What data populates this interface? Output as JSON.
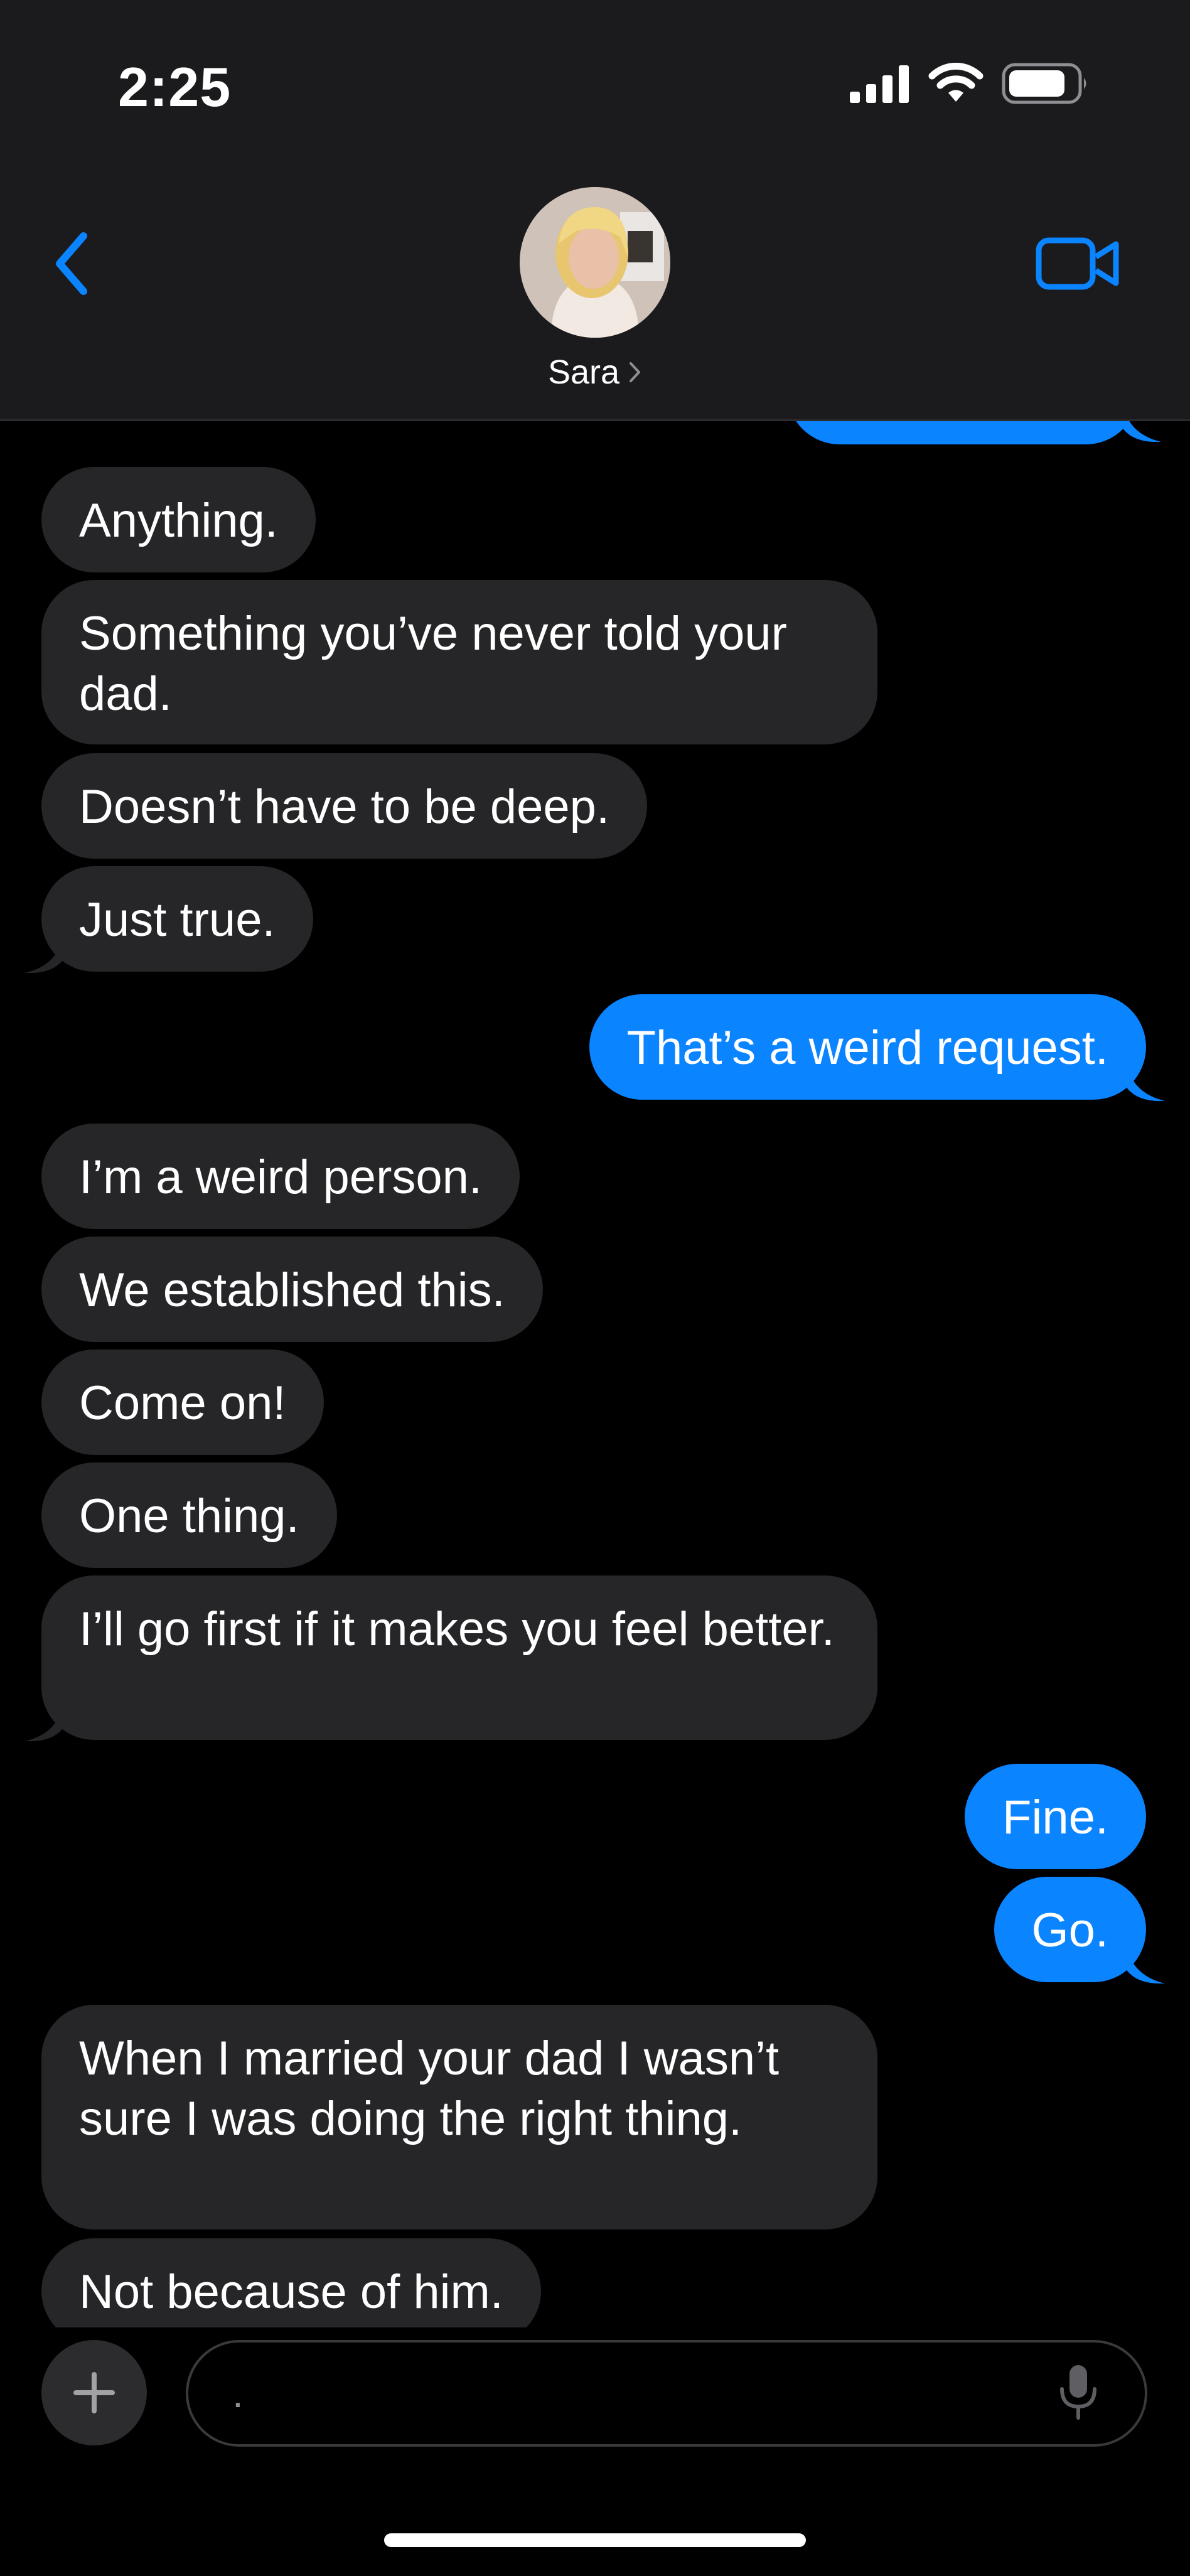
{
  "status_bar": {
    "time": "2:25",
    "signal_icon": "cellular-signal-icon",
    "wifi_icon": "wifi-icon",
    "battery_icon": "battery-icon",
    "battery_level": 0.85
  },
  "header": {
    "back_icon": "chevron-left-icon",
    "contact_name": "Sara",
    "contact_chevron": ">",
    "video_icon": "video-camera-icon"
  },
  "colors": {
    "incoming_bubble": "#262628",
    "outgoing_bubble": "#0a84ff",
    "accent": "#0a84ff",
    "header_background": "#1b1b1d"
  },
  "messages": [
    {
      "direction": "in",
      "text": "Anything."
    },
    {
      "direction": "in",
      "text": "Something you’ve never told your dad."
    },
    {
      "direction": "in",
      "text": "Doesn’t have to be deep."
    },
    {
      "direction": "in",
      "text": "Just true."
    },
    {
      "direction": "out",
      "text": "That’s a weird request."
    },
    {
      "direction": "in",
      "text": "I’m a weird person."
    },
    {
      "direction": "in",
      "text": "We established this."
    },
    {
      "direction": "in",
      "text": "Come on!"
    },
    {
      "direction": "in",
      "text": "One thing."
    },
    {
      "direction": "in",
      "text": "I’ll go first if it makes you feel better."
    },
    {
      "direction": "out",
      "text": "Fine."
    },
    {
      "direction": "out",
      "text": "Go."
    },
    {
      "direction": "in",
      "text": "When I married your dad I wasn’t sure I was doing the right thing."
    },
    {
      "direction": "in",
      "text": "Not because of him."
    }
  ],
  "input_bar": {
    "plus_icon": "plus-icon",
    "input_value": ".",
    "mic_icon": "microphone-icon"
  }
}
